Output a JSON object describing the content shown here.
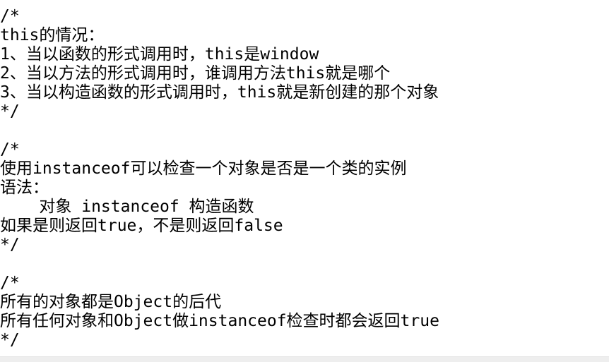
{
  "lines": [
    "/*",
    "this的情况：",
    "1、当以函数的形式调用时，this是window",
    "2、当以方法的形式调用时，谁调用方法this就是哪个",
    "3、当以构造函数的形式调用时，this就是新创建的那个对象",
    "*/",
    "",
    "/*",
    "使用instanceof可以检查一个对象是否是一个类的实例",
    "语法：",
    "    对象 instanceof 构造函数",
    "如果是则返回true，不是则返回false",
    "*/",
    "",
    "/*",
    "所有的对象都是Object的后代",
    "所有任何对象和Object做instanceof检查时都会返回true",
    "*/"
  ]
}
